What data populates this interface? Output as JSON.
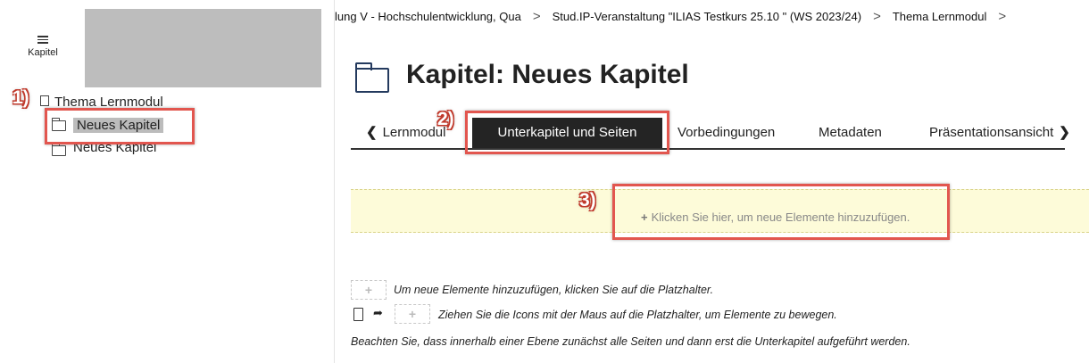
{
  "sidebar": {
    "toggle_label": "Kapitel",
    "tree": {
      "root_label": "Thema Lernmodul",
      "items": [
        {
          "label": "Neues Kapitel",
          "selected": true
        },
        {
          "label": "Neues Kapitel",
          "selected": false
        }
      ]
    }
  },
  "breadcrumb": {
    "items": [
      "lung V - Hochschulentwicklung, Qua",
      "Stud.IP-Veranstaltung \"ILIAS Testkurs 25.10 \" (WS 2023/24)",
      "Thema Lernmodul"
    ],
    "separator": ">"
  },
  "page": {
    "title": "Kapitel: Neues Kapitel"
  },
  "tabs": {
    "back_label": "Lernmodul",
    "items": [
      "Unterkapitel und Seiten",
      "Vorbedingungen",
      "Metadaten",
      "Präsentationsansicht"
    ],
    "active": "Unterkapitel und Seiten"
  },
  "content": {
    "add_placeholder": "Klicken Sie hier, um neue Elemente hinzuzufügen.",
    "help_1": "Um neue Elemente hinzuzufügen, klicken Sie auf die Platzhalter.",
    "help_2": "Ziehen Sie die Icons mit der Maus auf die Platzhalter, um Elemente zu bewegen.",
    "help_3": "Beachten Sie, dass innerhalb einer Ebene zunächst alle Seiten und dann erst die Unterkapitel aufgeführt werden."
  },
  "annotations": {
    "step1": "1)",
    "step2": "2)",
    "step3": "3)"
  },
  "colors": {
    "highlight": "#e2564f",
    "active_tab": "#242424",
    "placeholder_bg": "#fdfbd9"
  }
}
